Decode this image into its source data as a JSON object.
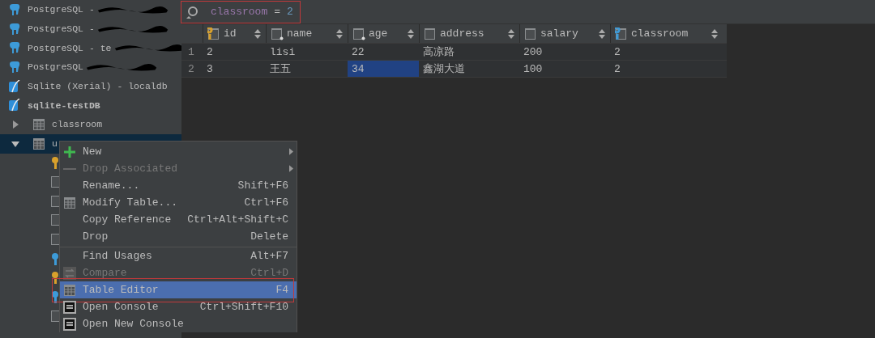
{
  "sidebar": {
    "items": [
      {
        "label": "PostgreSQL -",
        "kind": "postgres",
        "bold": false,
        "redacted": true
      },
      {
        "label": "PostgreSQL -",
        "kind": "postgres",
        "bold": false,
        "redacted": true
      },
      {
        "label": "PostgreSQL - te",
        "kind": "postgres",
        "bold": false,
        "redacted": true
      },
      {
        "label": "PostgreSQL",
        "kind": "postgres",
        "bold": false,
        "redacted": true
      },
      {
        "label": "Sqlite (Xerial) - localdb",
        "kind": "sqlite",
        "bold": false,
        "redacted": false
      },
      {
        "label": "sqlite-testDB",
        "kind": "sqlite",
        "bold": true,
        "redacted": false
      },
      {
        "label": "classroom",
        "kind": "table",
        "expanded": false,
        "selected": false,
        "redacted": false
      },
      {
        "label": "u",
        "kind": "table",
        "expanded": true,
        "selected": true,
        "children": [
          {
            "kind": "key"
          },
          {
            "kind": "column"
          },
          {
            "kind": "column"
          },
          {
            "kind": "column"
          },
          {
            "kind": "column"
          },
          {
            "kind": "foreign-key"
          },
          {
            "kind": "key"
          },
          {
            "kind": "foreign-key"
          },
          {
            "kind": "column"
          }
        ]
      }
    ]
  },
  "filter": {
    "column": "classroom",
    "operator": "=",
    "value": "2",
    "highlighted": true
  },
  "table": {
    "columns": [
      {
        "name": "id",
        "kind": "key"
      },
      {
        "name": "name",
        "kind": "column"
      },
      {
        "name": "age",
        "kind": "column"
      },
      {
        "name": "address",
        "kind": "plain"
      },
      {
        "name": "salary",
        "kind": "plain"
      },
      {
        "name": "classroom",
        "kind": "foreign-key"
      }
    ],
    "rows": [
      {
        "number": "1",
        "cells": [
          {
            "text": "2",
            "selected": false
          },
          {
            "text": "lisi",
            "selected": false
          },
          {
            "text": "22",
            "selected": false
          },
          {
            "text": "高凉路",
            "selected": false
          },
          {
            "text": "200",
            "selected": false
          },
          {
            "text": "2",
            "selected": false
          }
        ]
      },
      {
        "number": "2",
        "cells": [
          {
            "text": "3",
            "selected": false
          },
          {
            "text": "王五",
            "selected": false
          },
          {
            "text": "34",
            "selected": true
          },
          {
            "text": "鑫湖大道",
            "selected": false
          },
          {
            "text": "100",
            "selected": false
          },
          {
            "text": "2",
            "selected": false
          }
        ]
      }
    ]
  },
  "context_menu": {
    "items": [
      {
        "label": "New",
        "kind": "plus",
        "submenu": true,
        "disabled": false,
        "selected": false,
        "separator_before": false
      },
      {
        "label": "Drop Associated",
        "kind": "minus",
        "submenu": true,
        "disabled": true,
        "selected": false,
        "separator_before": false
      },
      {
        "label": "Rename...",
        "kind": "none",
        "shortcut": "Shift+F6",
        "submenu": false,
        "disabled": false,
        "selected": false,
        "separator_before": false
      },
      {
        "label": "Modify Table...",
        "kind": "table",
        "shortcut": "Ctrl+F6",
        "submenu": false,
        "disabled": false,
        "selected": false,
        "separator_before": false
      },
      {
        "label": "Copy Reference",
        "kind": "none",
        "shortcut": "Ctrl+Alt+Shift+C",
        "submenu": false,
        "disabled": false,
        "selected": false,
        "separator_before": false
      },
      {
        "label": "Drop",
        "kind": "none",
        "shortcut": "Delete",
        "submenu": false,
        "disabled": false,
        "selected": false,
        "separator_before": false
      },
      {
        "label": "Find Usages",
        "kind": "none",
        "shortcut": "Alt+F7",
        "submenu": false,
        "disabled": false,
        "selected": false,
        "separator_before": true
      },
      {
        "label": "Compare",
        "kind": "compare",
        "shortcut": "Ctrl+D",
        "submenu": false,
        "disabled": true,
        "selected": false,
        "separator_before": false
      },
      {
        "label": "Table Editor",
        "kind": "table",
        "shortcut": "F4",
        "submenu": false,
        "disabled": false,
        "selected": true,
        "highlighted": true,
        "separator_before": false
      },
      {
        "label": "Open Console",
        "kind": "console",
        "shortcut": "Ctrl+Shift+F10",
        "submenu": false,
        "disabled": false,
        "selected": false,
        "separator_before": false
      },
      {
        "label": "Open New Console",
        "kind": "console",
        "submenu": false,
        "disabled": false,
        "selected": false,
        "separator_before": false
      }
    ]
  }
}
